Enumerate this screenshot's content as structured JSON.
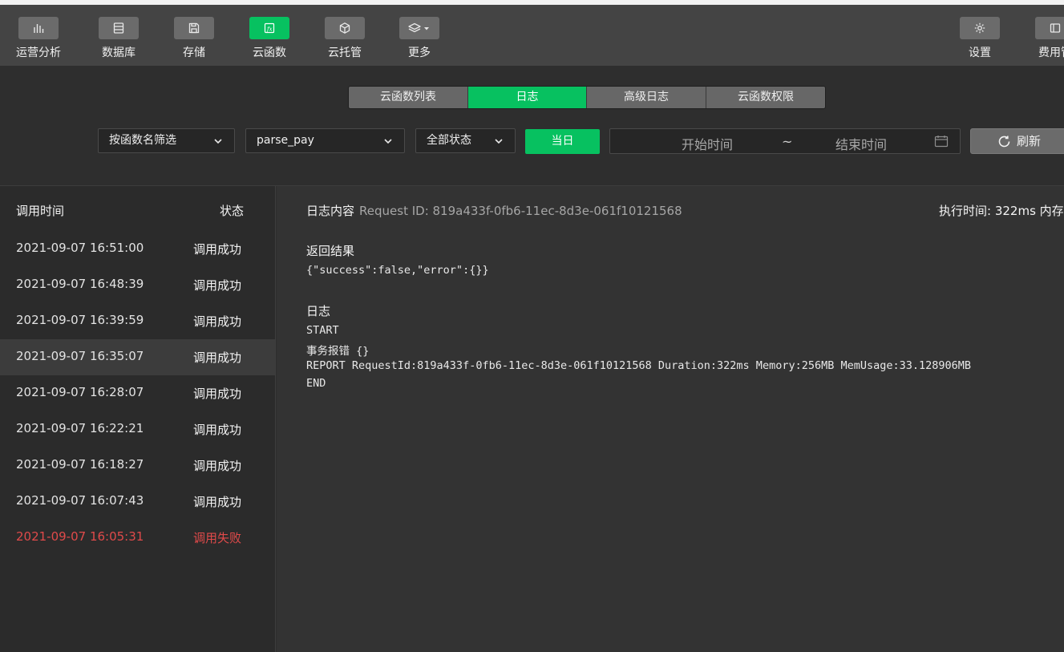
{
  "toolbar": {
    "items": [
      {
        "label": "运营分析",
        "icon": "bar-chart-icon"
      },
      {
        "label": "数据库",
        "icon": "database-icon"
      },
      {
        "label": "存储",
        "icon": "save-icon"
      },
      {
        "label": "云函数",
        "icon": "function-icon",
        "active": true
      },
      {
        "label": "云托管",
        "icon": "cube-icon"
      },
      {
        "label": "更多",
        "icon": "layers-icon"
      }
    ],
    "right_items": [
      {
        "label": "设置",
        "icon": "gear-icon"
      },
      {
        "label": "费用管",
        "icon": "billing-icon"
      }
    ]
  },
  "tabs": [
    {
      "label": "云函数列表"
    },
    {
      "label": "日志",
      "active": true
    },
    {
      "label": "高级日志"
    },
    {
      "label": "云函数权限"
    }
  ],
  "filters": {
    "filter_mode": "按函数名筛选",
    "function_name": "parse_pay",
    "status": "全部状态",
    "today_label": "当日",
    "start_placeholder": "开始时间",
    "tilde": "~",
    "end_placeholder": "结束时间",
    "refresh_label": "刷新"
  },
  "log_list": {
    "header_time": "调用时间",
    "header_status": "状态",
    "rows": [
      {
        "time": "2021-09-07 16:51:00",
        "status": "调用成功"
      },
      {
        "time": "2021-09-07 16:48:39",
        "status": "调用成功"
      },
      {
        "time": "2021-09-07 16:39:59",
        "status": "调用成功"
      },
      {
        "time": "2021-09-07 16:35:07",
        "status": "调用成功",
        "selected": true
      },
      {
        "time": "2021-09-07 16:28:07",
        "status": "调用成功"
      },
      {
        "time": "2021-09-07 16:22:21",
        "status": "调用成功"
      },
      {
        "time": "2021-09-07 16:18:27",
        "status": "调用成功"
      },
      {
        "time": "2021-09-07 16:07:43",
        "status": "调用成功"
      },
      {
        "time": "2021-09-07 16:05:31",
        "status": "调用失败",
        "failed": true
      }
    ]
  },
  "detail": {
    "title": "日志内容",
    "request_id": "Request ID: 819a433f-0fb6-11ec-8d3e-061f10121568",
    "exec_time": "执行时间: 322ms  内存",
    "result_title": "返回结果",
    "result_body": "{\"success\":false,\"error\":{}}",
    "log_title": "日志",
    "log_lines": [
      "START",
      "事务报错 {}",
      "REPORT RequestId:819a433f-0fb6-11ec-8d3e-061f10121568 Duration:322ms Memory:256MB MemUsage:33.128906MB",
      "END"
    ]
  },
  "colors": {
    "accent": "#07c160",
    "fail": "#e04a4a"
  }
}
